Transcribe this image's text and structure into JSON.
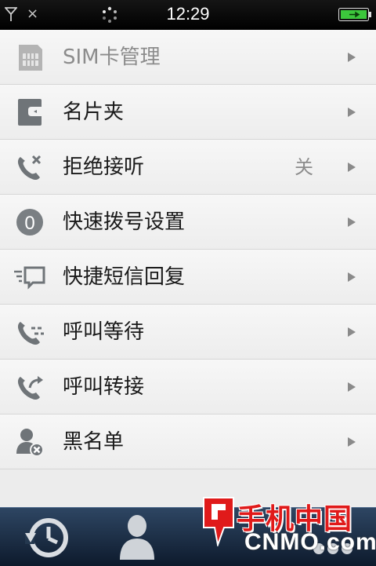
{
  "status_bar": {
    "time": "12:29",
    "icons": [
      "signal-icon",
      "close-icon",
      "busy-spinner-icon",
      "battery-icon"
    ]
  },
  "settings": {
    "items": [
      {
        "label": "SIM卡管理",
        "icon": "sim-card-icon",
        "disabled": true
      },
      {
        "label": "名片夹",
        "icon": "business-card-holder-icon"
      },
      {
        "label": "拒绝接听",
        "value": "关",
        "icon": "call-reject-icon"
      },
      {
        "label": "快速拨号设置",
        "icon": "speed-dial-icon",
        "icon_text": "0"
      },
      {
        "label": "快捷短信回复",
        "icon": "quick-sms-reply-icon"
      },
      {
        "label": "呼叫等待",
        "icon": "call-waiting-icon"
      },
      {
        "label": "呼叫转接",
        "icon": "call-forward-icon"
      },
      {
        "label": "黑名单",
        "icon": "blacklist-icon"
      }
    ]
  },
  "tab_bar": {
    "tabs": [
      {
        "name": "history",
        "icon": "history-clock-icon"
      },
      {
        "name": "contacts",
        "icon": "contact-person-icon"
      },
      {
        "name": "more",
        "icon": "more-icon"
      }
    ]
  },
  "watermark": {
    "cn_text": "手机中国",
    "en_text": "CNMO.com"
  },
  "colors": {
    "row_bg": "#f2f2f2",
    "row_divider": "#d6d6d6",
    "label_text": "#1a1a1a",
    "disabled_text": "#8c8c8c",
    "tabbar_bg": "#1c2e45",
    "battery_green": "#3cc63c"
  }
}
